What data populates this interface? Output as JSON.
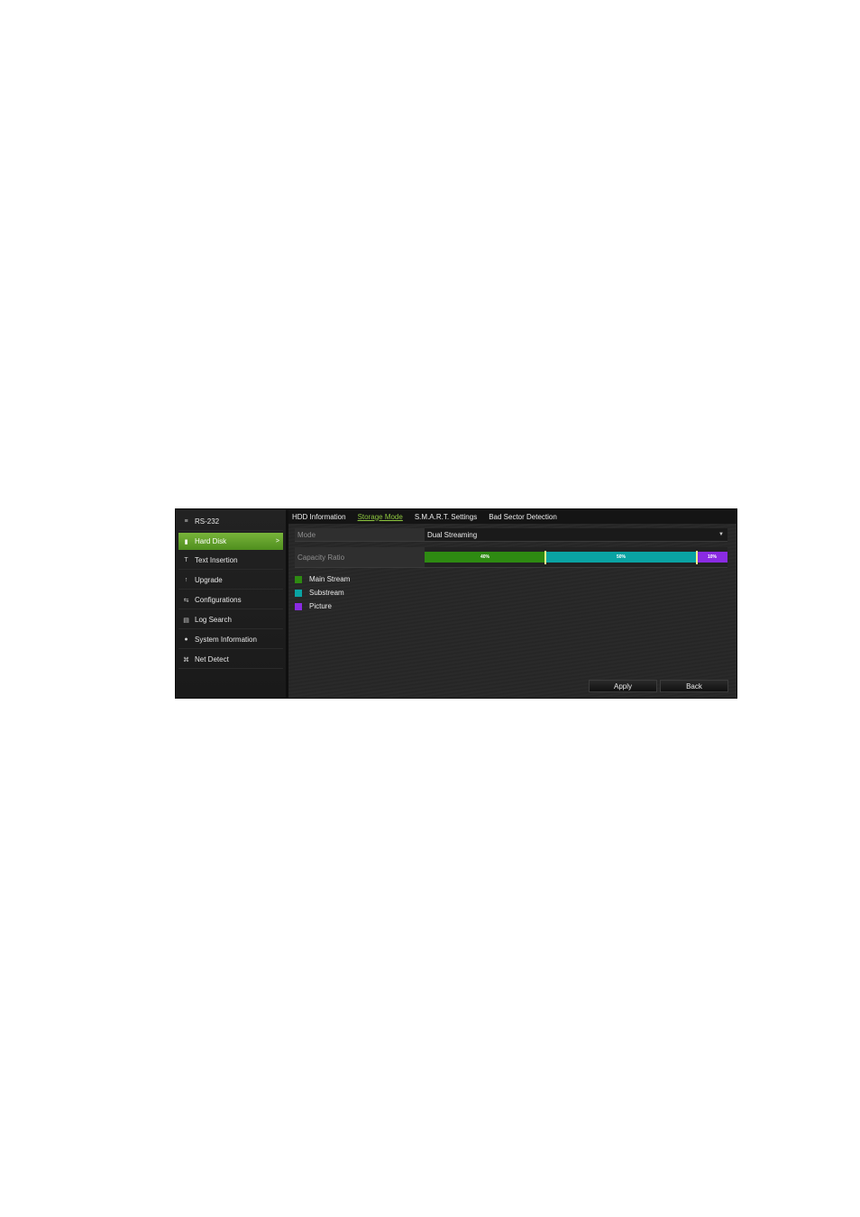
{
  "sidebar": {
    "items": [
      {
        "label": "RS-232",
        "icon": "rs232-icon",
        "glyph": "≡",
        "active": false
      },
      {
        "label": "Hard Disk",
        "icon": "hard-disk-icon",
        "glyph": "▮",
        "active": true
      },
      {
        "label": "Text Insertion",
        "icon": "text-insertion-icon",
        "glyph": "T",
        "active": false
      },
      {
        "label": "Upgrade",
        "icon": "upgrade-icon",
        "glyph": "↑",
        "active": false
      },
      {
        "label": "Configurations",
        "icon": "configurations-icon",
        "glyph": "⇆",
        "active": false
      },
      {
        "label": "Log Search",
        "icon": "log-search-icon",
        "glyph": "▤",
        "active": false
      },
      {
        "label": "System Information",
        "icon": "system-information-icon",
        "glyph": "●",
        "active": false
      },
      {
        "label": "Net Detect",
        "icon": "net-detect-icon",
        "glyph": "⌘",
        "active": false
      }
    ],
    "chevron": ">"
  },
  "tabs": [
    {
      "label": "HDD Information",
      "active": false
    },
    {
      "label": "Storage Mode",
      "active": true
    },
    {
      "label": "S.M.A.R.T. Settings",
      "active": false
    },
    {
      "label": "Bad Sector Detection",
      "active": false
    }
  ],
  "mode": {
    "label": "Mode",
    "value": "Dual Streaming"
  },
  "capacity": {
    "label": "Capacity Ratio",
    "segments": [
      {
        "name": "Main Stream",
        "percent": 40,
        "text": "40%",
        "color": "#2e8a12"
      },
      {
        "name": "Substream",
        "percent": 50,
        "text": "50%",
        "color": "#0aa3a3"
      },
      {
        "name": "Picture",
        "percent": 10,
        "text": "10%",
        "color": "#8a2be2"
      }
    ]
  },
  "buttons": {
    "apply": "Apply",
    "back": "Back"
  }
}
